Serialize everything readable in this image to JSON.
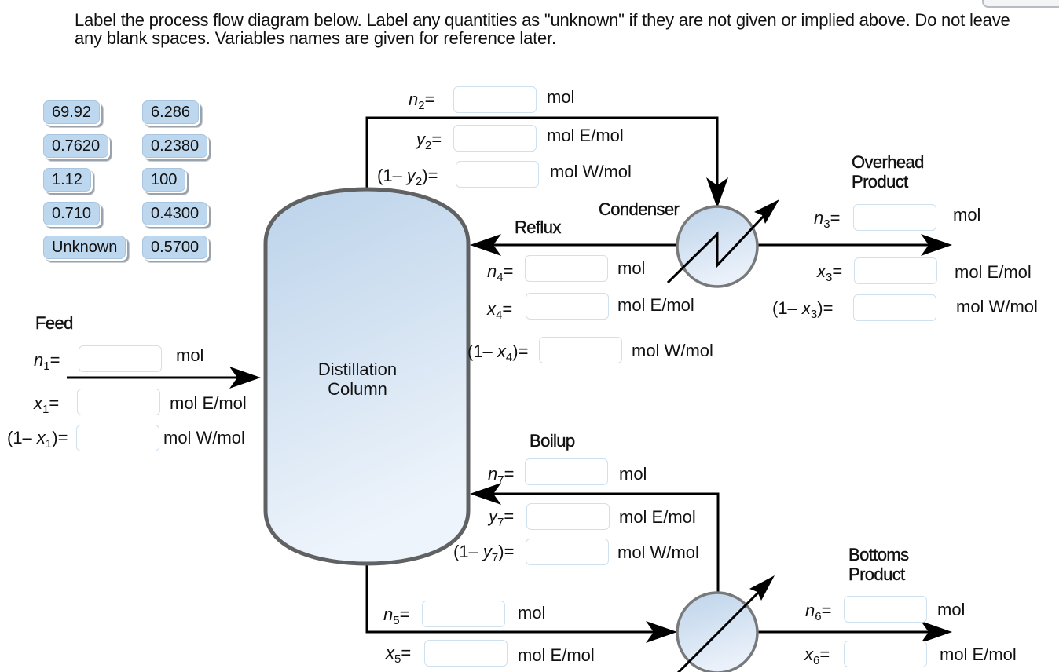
{
  "instructions": "Label the process flow diagram below. Label any quantities as \"unknown\" if they are not given or implied above. Do not leave any blank spaces. Variables names are given for reference later.",
  "answer_bank": [
    "69.92",
    "6.286",
    "0.7620",
    "0.2380",
    "1.12",
    "100",
    "0.710",
    "0.4300",
    "Unknown",
    "0.5700"
  ],
  "units": {
    "mol": "mol",
    "mol_e": "mol E/mol",
    "mol_w": "mol W/mol"
  },
  "equipment": {
    "column": "Distillation Column",
    "condenser": "Condenser"
  },
  "streams": {
    "feed": {
      "title": "Feed",
      "n": {
        "var": "n",
        "sub": "1",
        "value": ""
      },
      "x": {
        "var": "x",
        "sub": "1",
        "value": ""
      },
      "one_minus": {
        "prefix": "(1– ",
        "var": "x",
        "sub": "1",
        "suffix": ")=",
        "value": ""
      }
    },
    "overhead_vapor": {
      "n": {
        "var": "n",
        "sub": "2",
        "value": ""
      },
      "y": {
        "var": "y",
        "sub": "2",
        "value": ""
      },
      "one_minus": {
        "prefix": "(1– ",
        "var": "y",
        "sub": "2",
        "suffix": ")=",
        "value": ""
      }
    },
    "overhead_product": {
      "title_line1": "Overhead",
      "title_line2": "Product",
      "n": {
        "var": "n",
        "sub": "3",
        "value": ""
      },
      "x": {
        "var": "x",
        "sub": "3",
        "value": ""
      },
      "one_minus": {
        "prefix": "(1– ",
        "var": "x",
        "sub": "3",
        "suffix": ")=",
        "value": ""
      }
    },
    "reflux": {
      "title": "Reflux",
      "n": {
        "var": "n",
        "sub": "4",
        "value": ""
      },
      "x": {
        "var": "x",
        "sub": "4",
        "value": ""
      },
      "one_minus": {
        "prefix": "(1– ",
        "var": "x",
        "sub": "4",
        "suffix": ")=",
        "value": ""
      }
    },
    "bottoms_liquid": {
      "n": {
        "var": "n",
        "sub": "5",
        "value": ""
      },
      "x": {
        "var": "x",
        "sub": "5",
        "value": ""
      }
    },
    "bottoms_product": {
      "title_line1": "Bottoms",
      "title_line2": "Product",
      "n": {
        "var": "n",
        "sub": "6",
        "value": ""
      },
      "x": {
        "var": "x",
        "sub": "6",
        "value": ""
      }
    },
    "boilup": {
      "title": "Boilup",
      "n": {
        "var": "n",
        "sub": "7",
        "value": ""
      },
      "y": {
        "var": "y",
        "sub": "7",
        "value": ""
      },
      "one_minus": {
        "prefix": "(1– ",
        "var": "y",
        "sub": "7",
        "suffix": ")=",
        "value": ""
      }
    }
  },
  "colors": {
    "chip_fill": "#bdd7ee",
    "vessel_top": "#bcd3ea",
    "vessel_bottom": "#eef4fb",
    "vessel_stroke": "#5f6163",
    "dropzone_border": "#cfe0ef"
  }
}
